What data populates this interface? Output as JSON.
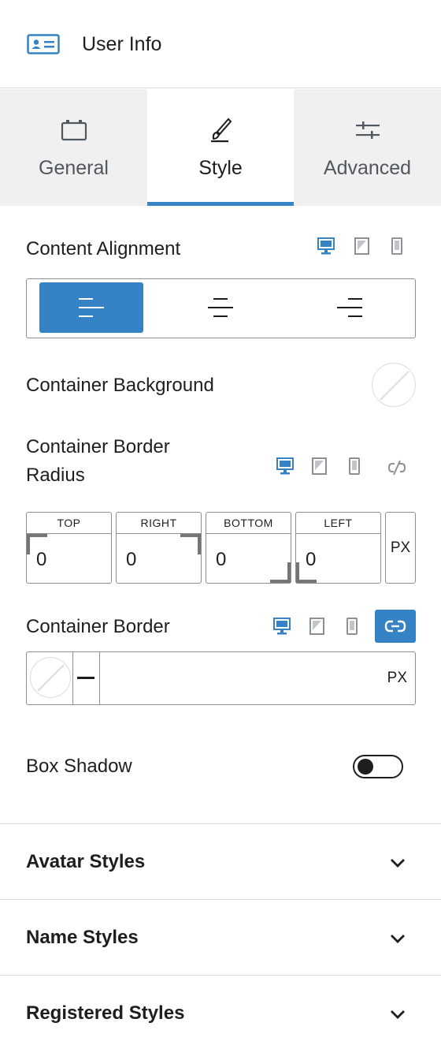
{
  "header": {
    "title": "User Info",
    "icon": "id-card-icon",
    "accent": "#3582c4"
  },
  "tabs": [
    {
      "label": "General",
      "icon": "layout-icon",
      "active": false
    },
    {
      "label": "Style",
      "icon": "brush-icon",
      "active": true
    },
    {
      "label": "Advanced",
      "icon": "sliders-icon",
      "active": false
    }
  ],
  "content_alignment": {
    "label": "Content Alignment",
    "devices": [
      "desktop-icon",
      "tablet-icon",
      "mobile-icon"
    ],
    "active_device": "desktop",
    "options": [
      "align-left-icon",
      "align-center-icon",
      "align-right-icon"
    ],
    "selected": "left"
  },
  "container_background": {
    "label": "Container Background",
    "value": "none"
  },
  "container_border_radius": {
    "label_line1": "Container Border",
    "label_line2": "Radius",
    "fields": [
      {
        "caption": "TOP",
        "value": "0"
      },
      {
        "caption": "RIGHT",
        "value": "0"
      },
      {
        "caption": "BOTTOM",
        "value": "0"
      },
      {
        "caption": "LEFT",
        "value": "0"
      }
    ],
    "unit": "PX",
    "linked": false
  },
  "container_border": {
    "label": "Container Border",
    "unit": "PX",
    "linked": true,
    "style": "solid"
  },
  "box_shadow": {
    "label": "Box Shadow",
    "enabled": false
  },
  "panels": [
    {
      "title": "Avatar Styles"
    },
    {
      "title": "Name Styles"
    },
    {
      "title": "Registered Styles"
    }
  ]
}
